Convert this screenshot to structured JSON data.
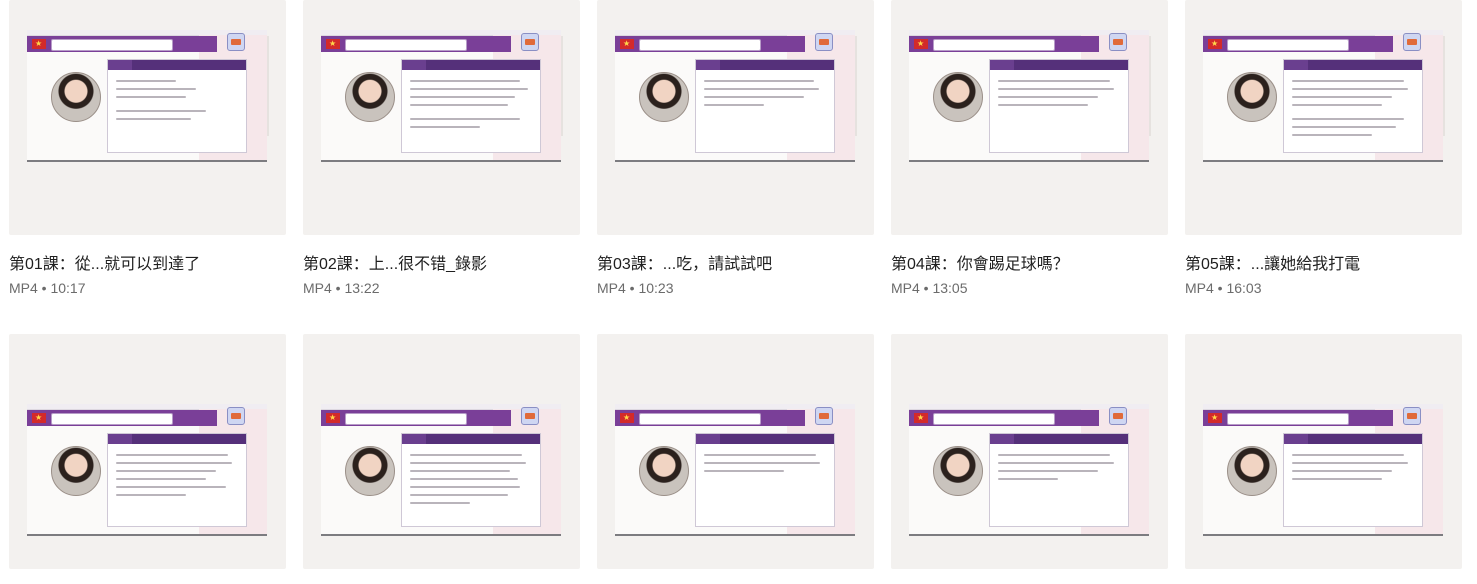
{
  "videos": [
    {
      "title": "第01課：從...就可以到達了",
      "meta": "MP4 • 10:17"
    },
    {
      "title": "第02課：上...很不错_錄影",
      "meta": "MP4 • 13:22"
    },
    {
      "title": "第03課：...吃，請試試吧",
      "meta": "MP4 • 10:23"
    },
    {
      "title": "第04課：你會踢足球嗎？",
      "meta": "MP4 • 13:05"
    },
    {
      "title": "第05課：...讓她給我打電",
      "meta": "MP4 • 16:03"
    },
    {
      "title": "",
      "meta": ""
    },
    {
      "title": "",
      "meta": ""
    },
    {
      "title": "",
      "meta": ""
    },
    {
      "title": "",
      "meta": ""
    },
    {
      "title": "",
      "meta": ""
    }
  ],
  "thumbnail_style": {
    "bar_color": "#7a3f98",
    "header_color": "#55307a",
    "flag_color": "#d32a2a",
    "pink_color": "#f6e7ea"
  }
}
